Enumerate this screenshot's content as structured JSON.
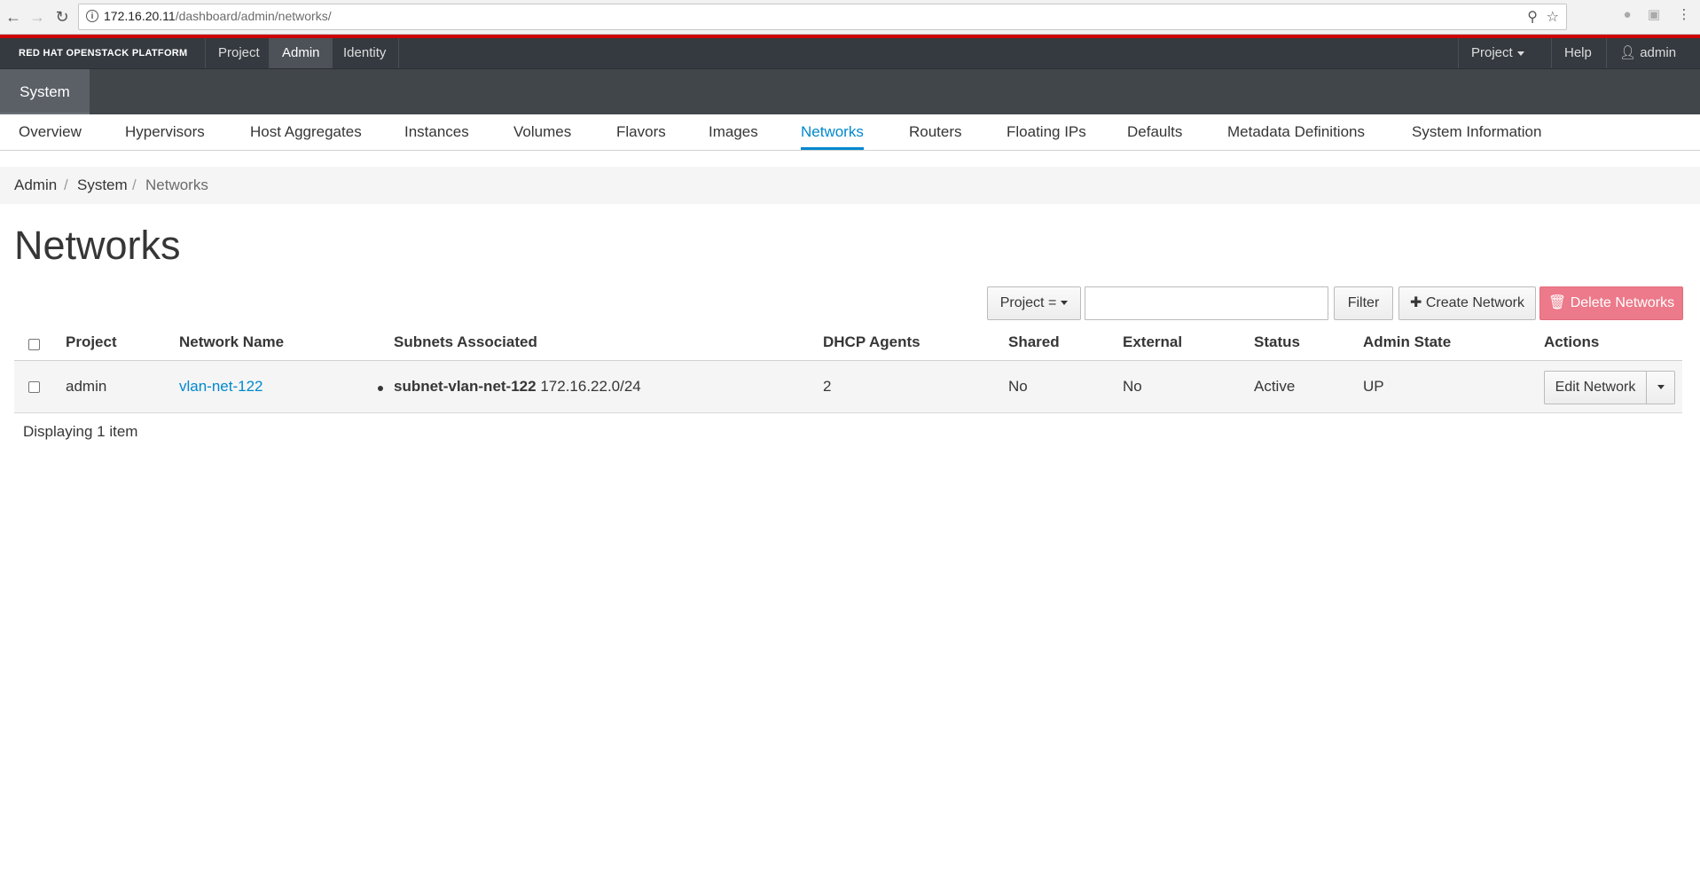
{
  "browser": {
    "url_host": "172.16.20.11",
    "url_path": "/dashboard/admin/networks/"
  },
  "brand": "RED HAT OPENSTACK PLATFORM",
  "topnav": {
    "items": [
      "Project",
      "Admin",
      "Identity"
    ],
    "active": "Admin",
    "right_project": "Project",
    "help": "Help",
    "user": "admin"
  },
  "section": "System",
  "tabs": [
    "Overview",
    "Hypervisors",
    "Host Aggregates",
    "Instances",
    "Volumes",
    "Flavors",
    "Images",
    "Networks",
    "Routers",
    "Floating IPs",
    "Defaults",
    "Metadata Definitions",
    "System Information"
  ],
  "active_tab": "Networks",
  "breadcrumb": [
    "Admin",
    "System",
    "Networks"
  ],
  "page_title": "Networks",
  "toolbar": {
    "filter_field": "Project =",
    "filter_value": "",
    "filter_button": "Filter",
    "create": "Create Network",
    "delete": "Delete Networks"
  },
  "table": {
    "columns": [
      "Project",
      "Network Name",
      "Subnets Associated",
      "DHCP Agents",
      "Shared",
      "External",
      "Status",
      "Admin State",
      "Actions"
    ],
    "rows": [
      {
        "project": "admin",
        "network_name": "vlan-net-122",
        "subnet_name": "subnet-vlan-net-122",
        "subnet_cidr": "172.16.22.0/24",
        "dhcp_agents": "2",
        "shared": "No",
        "external": "No",
        "status": "Active",
        "admin_state": "UP",
        "action": "Edit Network"
      }
    ],
    "footer": "Displaying 1 item"
  },
  "colors": {
    "accent": "#0088ce",
    "danger": "#ec7a8a",
    "brand_red": "#cc0000",
    "nav_dark": "#353a40"
  }
}
